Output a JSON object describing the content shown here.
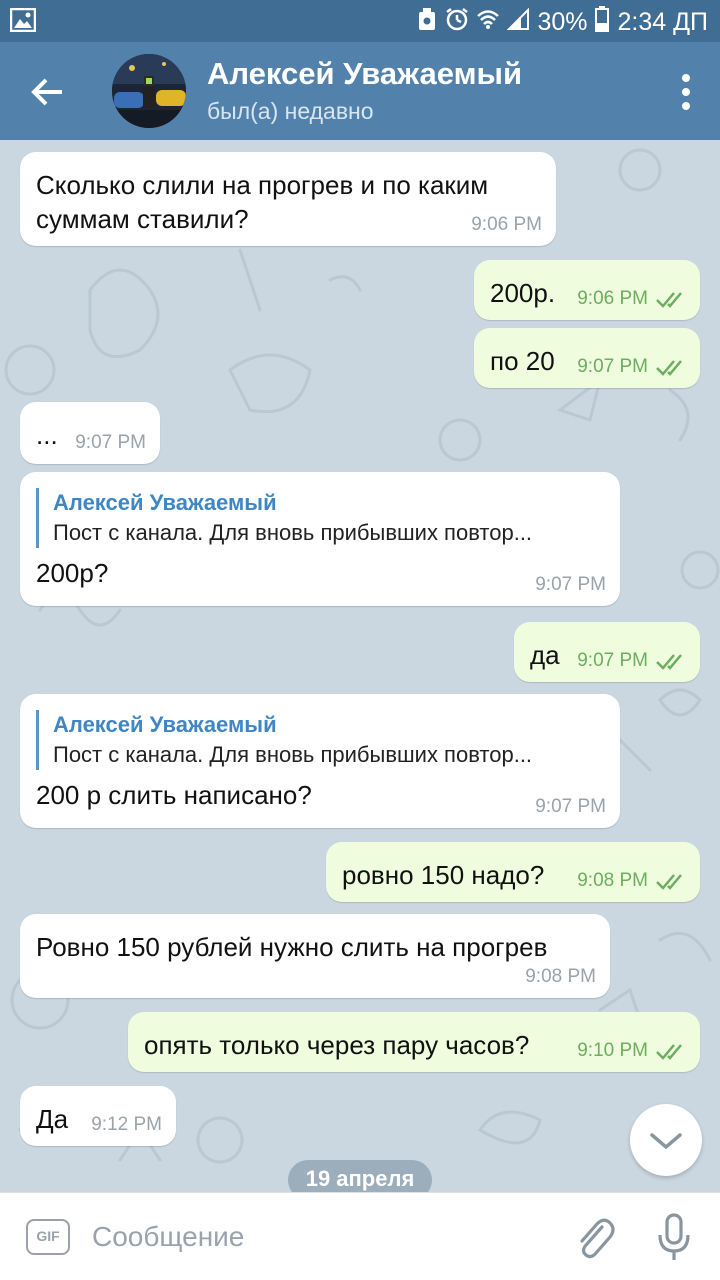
{
  "status_bar": {
    "battery": "30%",
    "time": "2:34 ДП"
  },
  "header": {
    "name": "Алексей Уважаемый",
    "status": "был(а) недавно"
  },
  "messages": [
    {
      "dir": "in",
      "text": "Сколько слили на прогрев и по каким\nсуммам ставили?",
      "time": "9:06 PM"
    },
    {
      "dir": "out",
      "text": "200р.",
      "time": "9:06 PM",
      "read": true
    },
    {
      "dir": "out",
      "text": "по 20",
      "time": "9:07 PM",
      "read": true
    },
    {
      "dir": "in",
      "text": "...",
      "time": "9:07 PM"
    },
    {
      "dir": "in",
      "reply_name": "Алексей Уважаемый",
      "reply_text": "Пост с канала. Для вновь прибывших повтор...",
      "text": "200р?",
      "time": "9:07 PM"
    },
    {
      "dir": "out",
      "text": "да",
      "time": "9:07 PM",
      "read": true
    },
    {
      "dir": "in",
      "reply_name": "Алексей Уважаемый",
      "reply_text": "Пост с канала. Для вновь прибывших повтор...",
      "text": "200 р слить написано?",
      "time": "9:07 PM"
    },
    {
      "dir": "out",
      "text": "ровно 150 надо?",
      "time": "9:08 PM",
      "read": true
    },
    {
      "dir": "in",
      "text": "Ровно 150 рублей нужно слить на прогрев",
      "time": "9:08 PM"
    },
    {
      "dir": "out",
      "text": "опять только через пару часов?",
      "time": "9:10 PM",
      "read": true
    },
    {
      "dir": "in",
      "text": "Да",
      "time": "9:12 PM"
    }
  ],
  "date_divider": "19 апреля",
  "input": {
    "gif_label": "GIF",
    "placeholder": "Сообщение"
  },
  "icons": {
    "back": "arrow-left-icon",
    "menu": "more-vertical-icon",
    "scroll": "chevron-down-icon",
    "attach": "paperclip-icon",
    "mic": "microphone-icon"
  },
  "colors": {
    "header": "#5282ab",
    "statusbar": "#3f6d94",
    "chat_bg": "#cbd7e0",
    "incoming": "#ffffff",
    "outgoing": "#effdde",
    "reply_name": "#3f86c4",
    "read_check": "#6cae5f"
  }
}
